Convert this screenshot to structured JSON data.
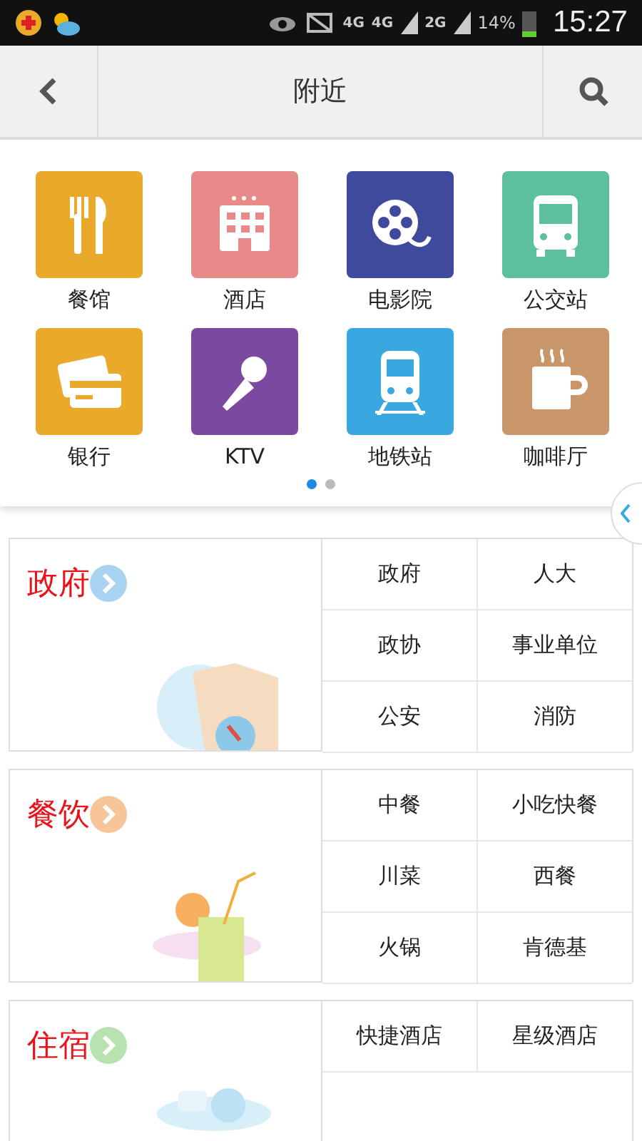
{
  "status_bar": {
    "network": [
      "4G",
      "4G",
      "2G"
    ],
    "battery": "14%",
    "time": "15:27"
  },
  "header": {
    "title": "附近"
  },
  "categories": [
    {
      "label": "餐馆",
      "color": "#e9a92a"
    },
    {
      "label": "酒店",
      "color": "#e98a8a"
    },
    {
      "label": "电影院",
      "color": "#3f4a9c"
    },
    {
      "label": "公交站",
      "color": "#5cc0a0"
    },
    {
      "label": "银行",
      "color": "#e9a92a"
    },
    {
      "label": "KTV",
      "color": "#7a4aa0"
    },
    {
      "label": "地铁站",
      "color": "#3aa8e0"
    },
    {
      "label": "咖啡厅",
      "color": "#c8966a"
    }
  ],
  "page_dots": [
    {
      "selected": true
    },
    {
      "selected": false
    }
  ],
  "sections": [
    {
      "title": "政府",
      "color": "#a8d4f2",
      "items": [
        "政府",
        "人大",
        "政协",
        "事业单位",
        "公安",
        "消防"
      ]
    },
    {
      "title": "餐饮",
      "color": "#f8c49a",
      "items": [
        "中餐",
        "小吃快餐",
        "川菜",
        "西餐",
        "火锅",
        "肯德基"
      ]
    },
    {
      "title": "住宿",
      "color": "#b8e2b0",
      "items": [
        "快捷酒店",
        "星级酒店"
      ]
    }
  ]
}
